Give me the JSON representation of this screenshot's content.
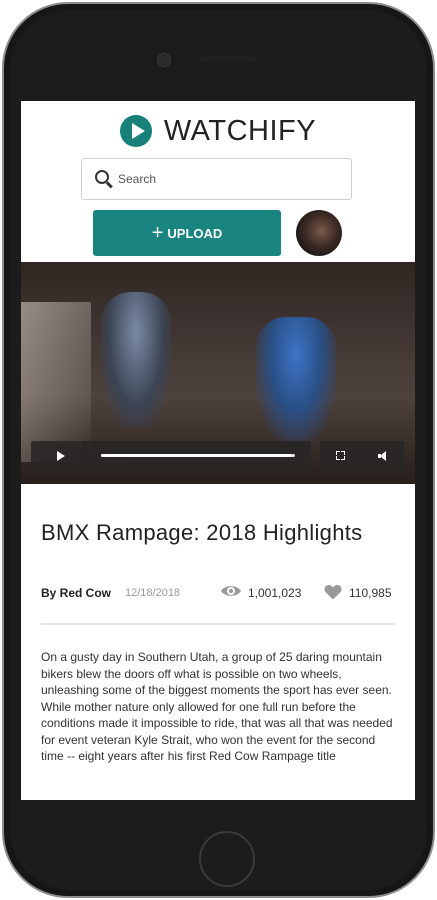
{
  "app": {
    "name": "WATCHIFY"
  },
  "search": {
    "placeholder": "Search"
  },
  "toolbar": {
    "upload_label": "UPLOAD"
  },
  "video": {
    "title": "BMX Rampage: 2018 Highlights",
    "author": "By Red Cow",
    "date": "12/18/2018",
    "views": "1,001,023",
    "likes": "110,985",
    "progress": 0.98,
    "description": "On a gusty day in Southern Utah, a group of 25 daring mountain bikers blew the doors off what is possible on two wheels, unleashing some of the biggest moments the sport has ever seen. While mother nature only allowed for one full run before the conditions made it impossible to ride, that was all that was needed for event veteran Kyle Strait, who won the event for the second time -- eight years after his first Red Cow Rampage title"
  },
  "colors": {
    "brand": "#168079",
    "upload_button": "#198480",
    "meta_icon": "#9a9a9a"
  },
  "icons": [
    "play-icon",
    "search-icon",
    "plus-icon",
    "fullscreen-icon",
    "volume-icon",
    "eye-icon",
    "heart-icon"
  ]
}
